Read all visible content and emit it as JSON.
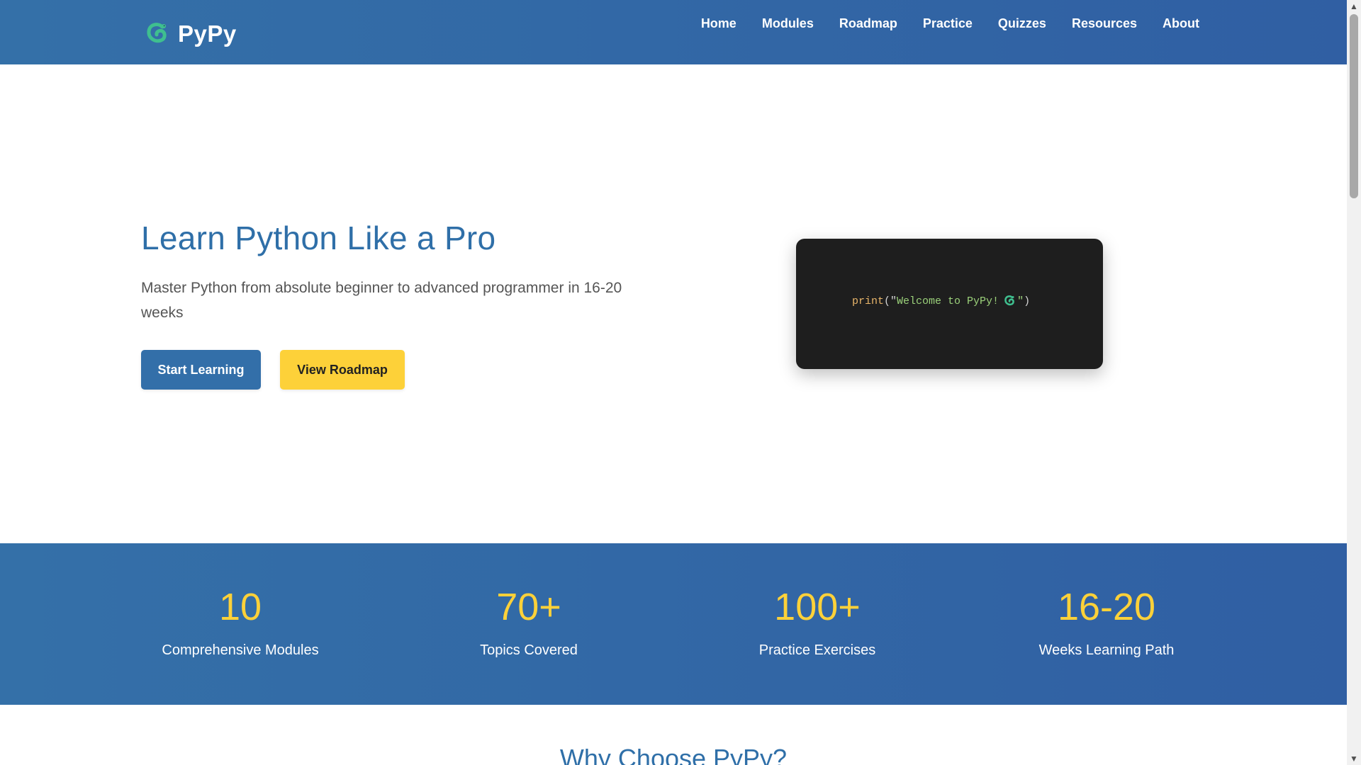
{
  "brand": {
    "name": "PyPy",
    "logo_icon": "python-snake-icon",
    "accent": "#3fbf8f"
  },
  "nav": {
    "items": [
      "Home",
      "Modules",
      "Roadmap",
      "Practice",
      "Quizzes",
      "Resources",
      "About"
    ]
  },
  "hero": {
    "title": "Learn Python Like a Pro",
    "subtitle": "Master Python from absolute beginner to advanced programmer in 16-20 weeks",
    "primary_button": "Start Learning",
    "secondary_button": "View Roadmap",
    "code": {
      "function": "print",
      "open": "(\"",
      "string": "Welcome to PyPy! ",
      "close_quote": "\"",
      "close_paren": ")"
    }
  },
  "stats": [
    {
      "value": "10",
      "label": "Comprehensive Modules"
    },
    {
      "value": "70+",
      "label": "Topics Covered"
    },
    {
      "value": "100+",
      "label": "Practice Exercises"
    },
    {
      "value": "16-20",
      "label": "Weeks Learning Path"
    }
  ],
  "section": {
    "title": "Why Choose PyPy?"
  },
  "colors": {
    "primary": "#336fa9",
    "accent_yellow": "#fdd139",
    "header_bg": "#3470a8",
    "code_bg": "#1e1e1e"
  }
}
